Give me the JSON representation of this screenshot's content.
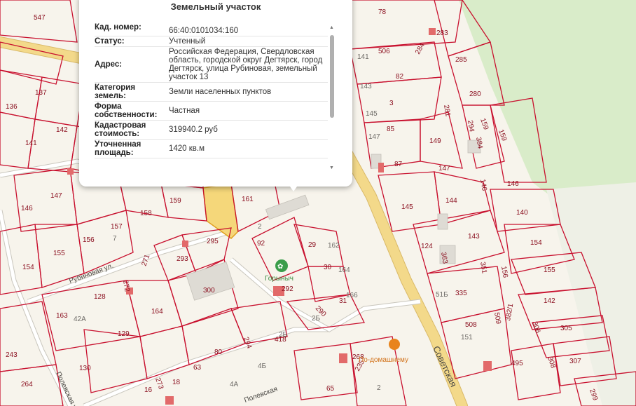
{
  "popup": {
    "title": "Земельный участок",
    "rows": [
      {
        "label": "Кад. номер:",
        "value": "66:40:0101034:160"
      },
      {
        "label": "Статус:",
        "value": "Учтенный"
      },
      {
        "label": "Адрес:",
        "value": "Российская Федерация, Свердловская область, городской округ Дегтярск, город Дегтярск, улица Рубиновая, земельный участок 13"
      },
      {
        "label": "Категория земель:",
        "value": "Земли населенных пунктов"
      },
      {
        "label": "Форма собственности:",
        "value": "Частная"
      },
      {
        "label": "Кадастровая стоимость:",
        "value": "319940.2 руб"
      },
      {
        "label": "Уточненная площадь:",
        "value": "1420 кв.м"
      }
    ]
  },
  "map": {
    "streets": {
      "rubinovaya": "Рубиновая ул.",
      "sovetskaya": "Советская",
      "polevskaya": "Полевская",
      "west": "Полевская ул."
    },
    "poi": {
      "gorynych": "Горыныч",
      "podomashnemu": "По-домашнему"
    },
    "plot_labels": [
      "547",
      "78",
      "283",
      "506",
      "284",
      "285",
      "141",
      "82",
      "137",
      "136",
      "143",
      "280",
      "3",
      "145",
      "281",
      "142",
      "85",
      "149",
      "159",
      "159",
      "141",
      "147",
      "87",
      "147",
      "294",
      "384",
      "146",
      "146",
      "147",
      "140",
      "146",
      "145",
      "144",
      "158",
      "159",
      "161",
      "162",
      "143",
      "157",
      "7",
      "2",
      "92",
      "29",
      "124",
      "154",
      "156",
      "155",
      "295",
      "293",
      "271",
      "30",
      "15",
      "363",
      "351",
      "155",
      "154",
      "128",
      "272",
      "300",
      "292",
      "164",
      "31",
      "156",
      "163",
      "42A",
      "164",
      "290",
      "335",
      "142",
      "129",
      "80",
      "294",
      "418",
      "508",
      "151",
      "509",
      "306",
      "305",
      "243",
      "130",
      "63",
      "2Б",
      "4Б",
      "268",
      "93",
      "382/1",
      "495",
      "308",
      "307",
      "264",
      "16",
      "273",
      "18",
      "4A",
      "235",
      "65",
      "2",
      "299"
    ],
    "colors": {
      "plot_border": "#c8102e",
      "highlight": "#f5d77a",
      "main_road": "#f3d98a",
      "forest": "#d9ecc9",
      "poi_green": "#3a9d4a",
      "poi_orange": "#e8841d"
    }
  }
}
